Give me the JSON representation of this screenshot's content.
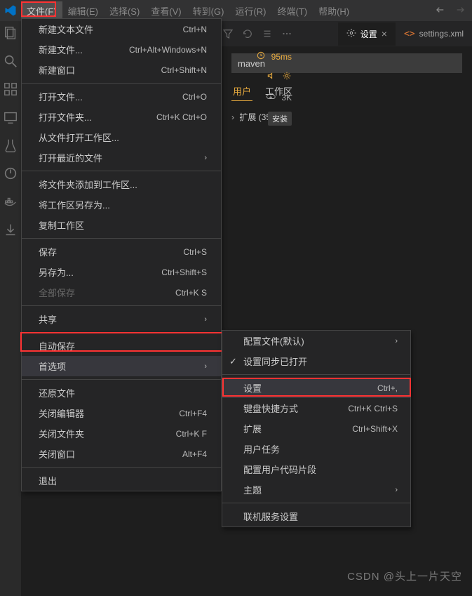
{
  "menubar": {
    "items": [
      {
        "label": "文件(F)"
      },
      {
        "label": "编辑(E)"
      },
      {
        "label": "选择(S)"
      },
      {
        "label": "查看(V)"
      },
      {
        "label": "转到(G)"
      },
      {
        "label": "运行(R)"
      },
      {
        "label": "终端(T)"
      },
      {
        "label": "帮助(H)"
      }
    ]
  },
  "fileMenu": {
    "items": [
      {
        "label": "新建文本文件",
        "shortcut": "Ctrl+N",
        "type": "item"
      },
      {
        "label": "新建文件...",
        "shortcut": "Ctrl+Alt+Windows+N",
        "type": "item"
      },
      {
        "label": "新建窗口",
        "shortcut": "Ctrl+Shift+N",
        "type": "item"
      },
      {
        "type": "sep"
      },
      {
        "label": "打开文件...",
        "shortcut": "Ctrl+O",
        "type": "item"
      },
      {
        "label": "打开文件夹...",
        "shortcut": "Ctrl+K Ctrl+O",
        "type": "item"
      },
      {
        "label": "从文件打开工作区...",
        "shortcut": "",
        "type": "item"
      },
      {
        "label": "打开最近的文件",
        "shortcut": "",
        "type": "submenu"
      },
      {
        "type": "sep"
      },
      {
        "label": "将文件夹添加到工作区...",
        "shortcut": "",
        "type": "item"
      },
      {
        "label": "将工作区另存为...",
        "shortcut": "",
        "type": "item"
      },
      {
        "label": "复制工作区",
        "shortcut": "",
        "type": "item"
      },
      {
        "type": "sep"
      },
      {
        "label": "保存",
        "shortcut": "Ctrl+S",
        "type": "item"
      },
      {
        "label": "另存为...",
        "shortcut": "Ctrl+Shift+S",
        "type": "item"
      },
      {
        "label": "全部保存",
        "shortcut": "Ctrl+K S",
        "type": "item",
        "disabled": true
      },
      {
        "type": "sep"
      },
      {
        "label": "共享",
        "shortcut": "",
        "type": "submenu"
      },
      {
        "type": "sep"
      },
      {
        "label": "自动保存",
        "shortcut": "",
        "type": "item"
      },
      {
        "label": "首选项",
        "shortcut": "",
        "type": "submenu",
        "selected": true
      },
      {
        "type": "sep"
      },
      {
        "label": "还原文件",
        "shortcut": "",
        "type": "item"
      },
      {
        "label": "关闭编辑器",
        "shortcut": "Ctrl+F4",
        "type": "item"
      },
      {
        "label": "关闭文件夹",
        "shortcut": "Ctrl+K F",
        "type": "item"
      },
      {
        "label": "关闭窗口",
        "shortcut": "Alt+F4",
        "type": "item"
      },
      {
        "type": "sep"
      },
      {
        "label": "退出",
        "shortcut": "",
        "type": "item"
      }
    ]
  },
  "prefSubmenu": {
    "items": [
      {
        "label": "配置文件(默认)",
        "shortcut": "",
        "type": "submenu"
      },
      {
        "label": "设置同步已打开",
        "shortcut": "",
        "type": "item",
        "checked": true
      },
      {
        "type": "sep"
      },
      {
        "label": "设置",
        "shortcut": "Ctrl+,",
        "type": "item",
        "selected": true
      },
      {
        "label": "键盘快捷方式",
        "shortcut": "Ctrl+K Ctrl+S",
        "type": "item"
      },
      {
        "label": "扩展",
        "shortcut": "Ctrl+Shift+X",
        "type": "item"
      },
      {
        "label": "用户任务",
        "shortcut": "",
        "type": "item"
      },
      {
        "label": "配置用户代码片段",
        "shortcut": "",
        "type": "item"
      },
      {
        "label": "主题",
        "shortcut": "",
        "type": "submenu"
      },
      {
        "type": "sep"
      },
      {
        "label": "联机服务设置",
        "shortcut": "",
        "type": "item"
      }
    ]
  },
  "editorTabs": {
    "settings": "设置",
    "settingsXml": "settings.xml"
  },
  "rightPanel": {
    "searchValue": "maven",
    "userTab": "用户",
    "workspaceTab": "工作区",
    "extensionsLabel": "扩展 (35)"
  },
  "midPeek": {
    "time": "95ms",
    "downloads": "3K",
    "install": "安装"
  },
  "watermark": "CSDN @头上一片天空"
}
